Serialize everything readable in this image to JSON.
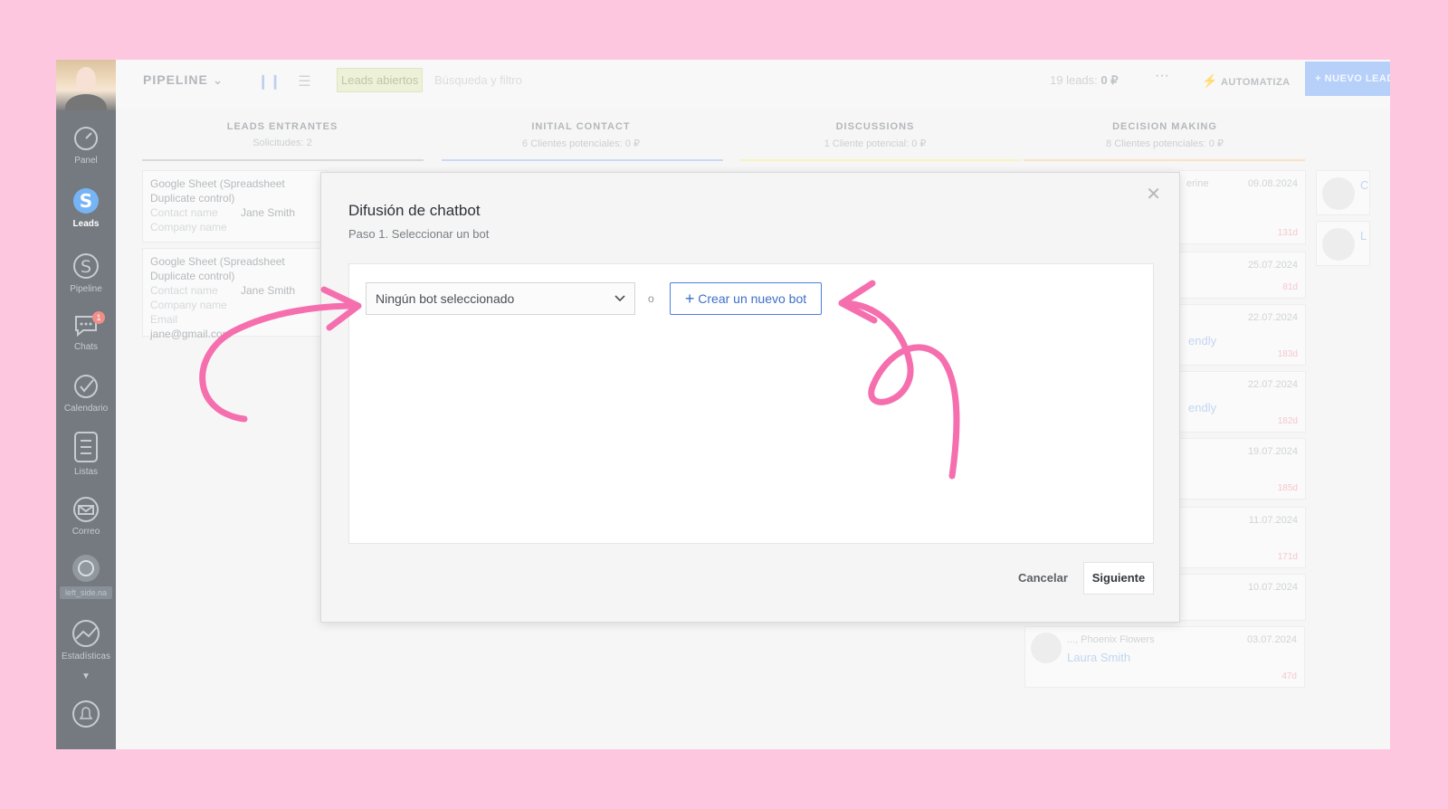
{
  "sidebar": {
    "items": [
      {
        "label": "Panel",
        "icon": "dashboard-icon"
      },
      {
        "label": "Leads",
        "icon": "leads-dollar-icon",
        "active": true
      },
      {
        "label": "Pipeline",
        "icon": "pipeline-dollar-icon"
      },
      {
        "label": "Chats",
        "icon": "chat-icon",
        "badge": "1"
      },
      {
        "label": "Calendario",
        "icon": "checkmark-icon"
      },
      {
        "label": "Listas",
        "icon": "list-icon"
      },
      {
        "label": "Correo",
        "icon": "mail-icon"
      },
      {
        "label": "left_side.na",
        "icon": "whatsapp-icon"
      },
      {
        "label": "Estadísticas",
        "icon": "stats-icon"
      }
    ]
  },
  "topbar": {
    "title": "PIPELINE",
    "filter_tag": "Leads abiertos",
    "search_placeholder": "Búsqueda y filtro",
    "leads_count_prefix": "19 leads:",
    "leads_count_value": "0 ₽",
    "more": "···",
    "automate": "AUTOMATIZA",
    "new_lead": "+ NUEVO LEAD"
  },
  "columns": [
    {
      "title": "LEADS ENTRANTES",
      "subtitle": "Solicitudes: 2",
      "color": "#c3c7cb"
    },
    {
      "title": "INITIAL CONTACT",
      "subtitle": "6 Clientes potenciales: 0 ₽",
      "color": "#aec6ef"
    },
    {
      "title": "DISCUSSIONS",
      "subtitle": "1 Cliente potencial: 0 ₽",
      "color": "#f3ee9e"
    },
    {
      "title": "DECISION MAKING",
      "subtitle": "8 Clientes potenciales: 0 ₽",
      "color": "#f6d3a8"
    }
  ],
  "lead_cards": [
    {
      "title": "Google Sheet (Spreadsheet Duplicate control)",
      "contact_label": "Contact name",
      "contact": "Jane Smith",
      "company_label": "Company name"
    },
    {
      "title": "Google Sheet (Spreadsheet Duplicate control)",
      "contact_label": "Contact name",
      "contact": "Jane Smith",
      "company_label": "Company name",
      "email_label": "Email",
      "email": "jane@gmail.com"
    }
  ],
  "right_cards": [
    {
      "date": "09.08.2024",
      "prefix": "erine",
      "days": "131d"
    },
    {
      "date": "25.07.2024",
      "days": "81d"
    },
    {
      "date": "22.07.2024",
      "name": "endly",
      "days": "183d"
    },
    {
      "date": "22.07.2024",
      "name": "endly",
      "days": "182d"
    },
    {
      "date": "19.07.2024",
      "days": "185d"
    },
    {
      "date": "11.07.2024",
      "days": "171d"
    },
    {
      "date": "10.07.2024",
      "days": ""
    },
    {
      "date": "03.07.2024",
      "company": "..., Phoenix Flowers",
      "name": "Laura Smith",
      "days": "47d"
    }
  ],
  "mini_cards": [
    {
      "initial": "C"
    },
    {
      "initial": "L"
    }
  ],
  "modal": {
    "title": "Difusión de chatbot",
    "subtitle": "Paso 1. Seleccionar un bot",
    "select_value": "Ningún bot seleccionado",
    "or": "o",
    "new_bot": "Crear un nuevo bot",
    "cancel": "Cancelar",
    "next": "Siguiente"
  },
  "colors": {
    "background": "#fdc8df",
    "sidebar": "#2b343d",
    "accent": "#3d6fc9",
    "annotation_arrow": "#f56fae"
  }
}
